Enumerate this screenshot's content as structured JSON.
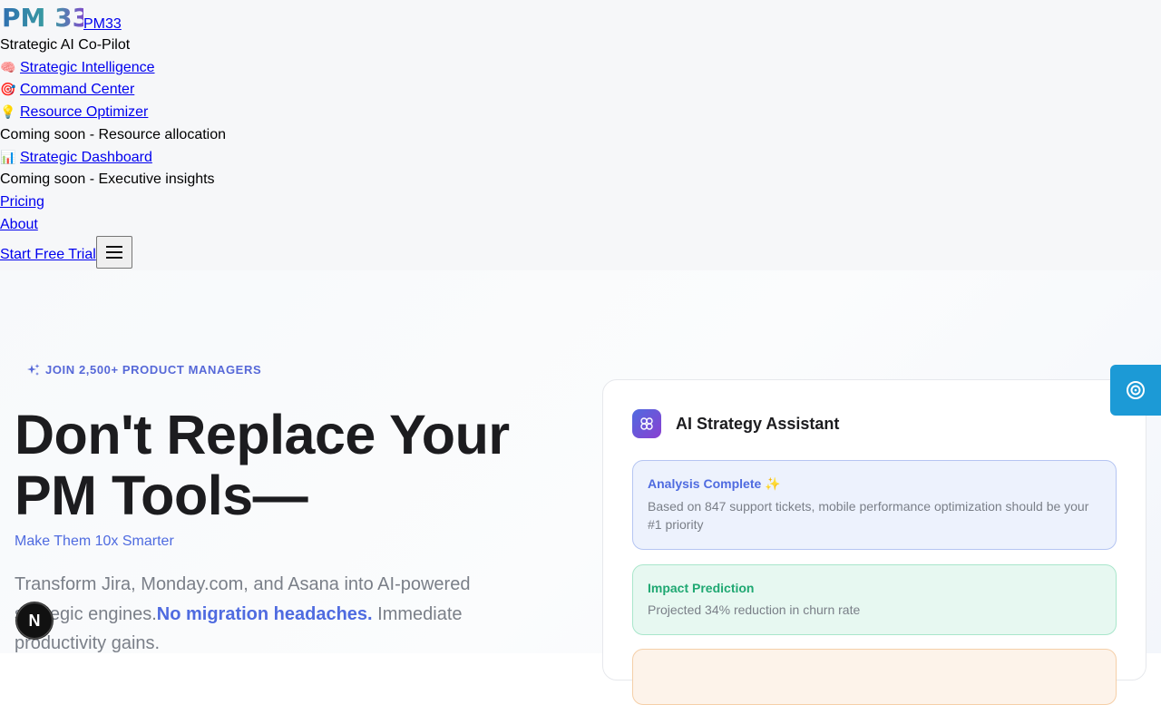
{
  "nav": {
    "brand_name": "PM33",
    "logo_text": "PM 33",
    "tagline": "Strategic AI Co-Pilot",
    "items": [
      {
        "emoji": "🧠",
        "label": "Strategic Intelligence"
      },
      {
        "emoji": "🎯",
        "label": "Command Center"
      },
      {
        "emoji": "💡",
        "label": "Resource Optimizer",
        "note": "Coming soon - Resource allocation"
      },
      {
        "emoji": "📊",
        "label": "Strategic Dashboard",
        "note": "Coming soon - Executive insights"
      }
    ],
    "pricing": "Pricing",
    "about": "About",
    "cta": "Start Free Trial",
    "menu_icon": "hamburger-icon"
  },
  "hero": {
    "badge": "JOIN 2,500+ PRODUCT MANAGERS",
    "headline_line1": "Don't Replace Your",
    "headline_line2": "PM Tools—",
    "subhead": "Make Them 10x Smarter",
    "desc_part1": "Transform Jira, Monday.com, and Asana into AI-powered strategic engines.",
    "desc_highlight": "No migration headaches.",
    "desc_part2": " Immediate productivity gains."
  },
  "assistant": {
    "title": "AI Strategy Assistant",
    "messages": [
      {
        "title": "Analysis Complete",
        "emoji": "✨",
        "text": "Based on 847 support tickets, mobile performance optimization should be your #1 priority"
      },
      {
        "title": "Impact Prediction",
        "text": "Projected 34% reduction in churn rate"
      }
    ]
  },
  "widgets": {
    "floating_icon": "target-icon",
    "dev_badge": "N"
  },
  "colors": {
    "accent": "#4f6be0",
    "success": "#1fa872",
    "floating": "#1c9ad6"
  }
}
